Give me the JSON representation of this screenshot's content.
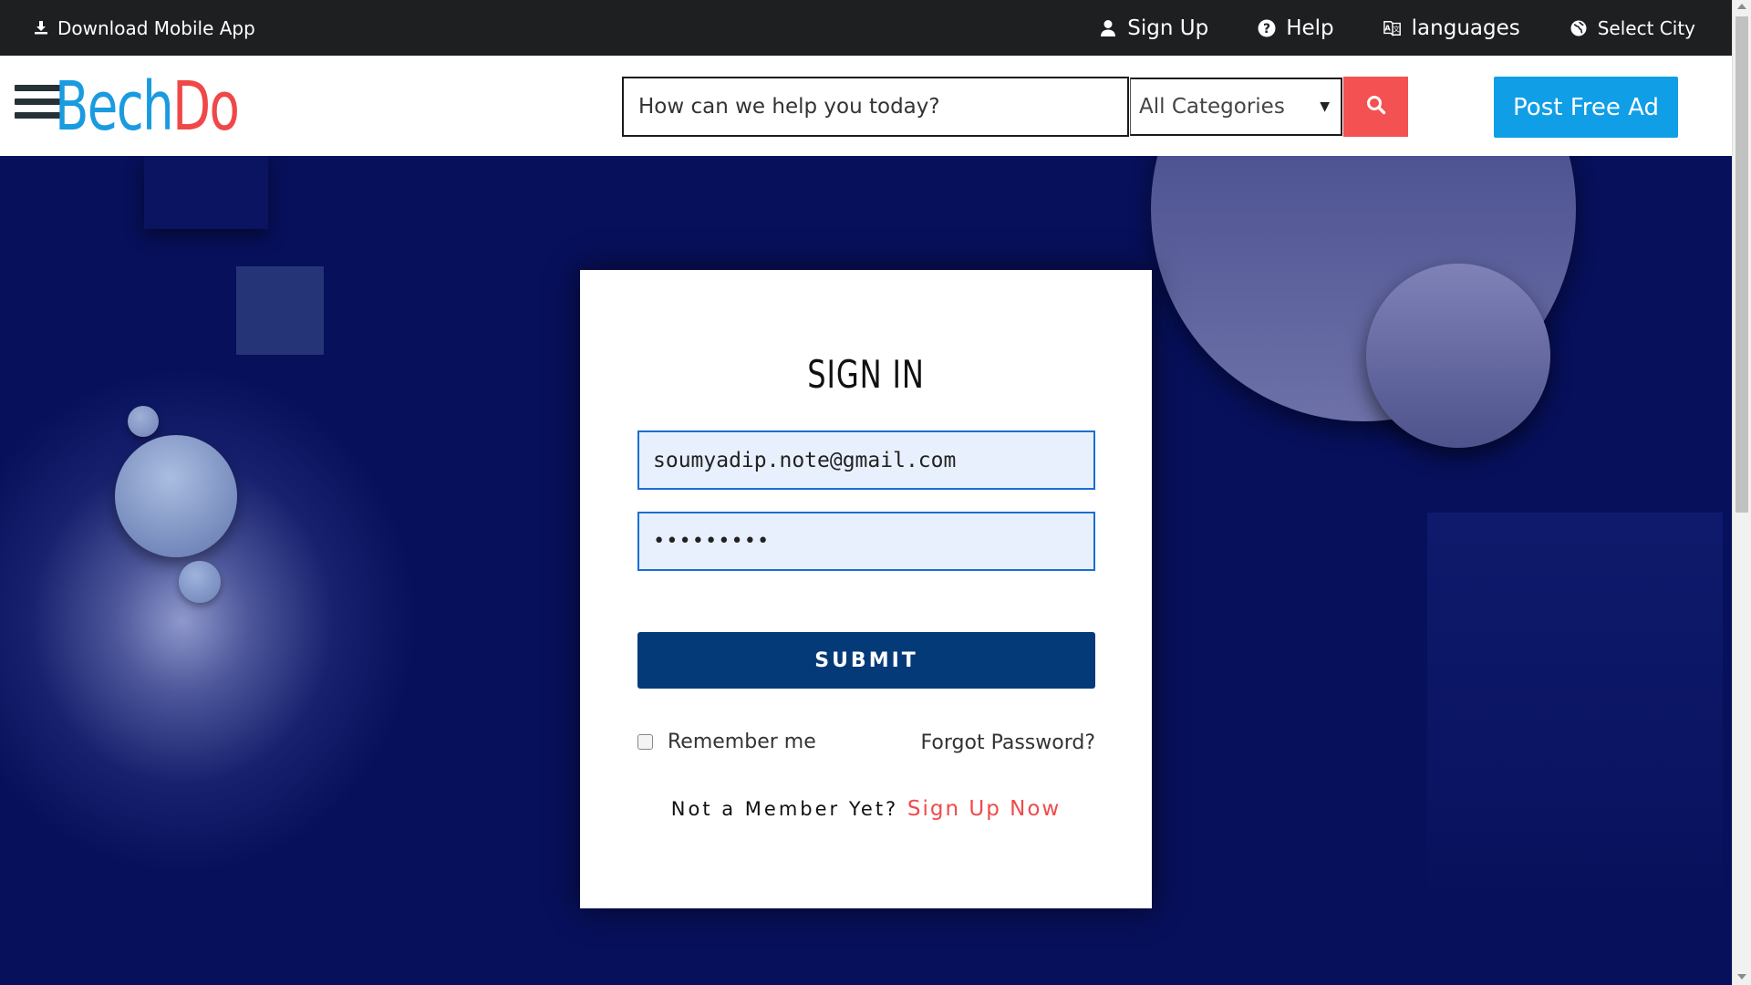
{
  "topbar": {
    "download_label": "Download Mobile App",
    "signup_label": "Sign Up",
    "help_label": "Help",
    "languages_label": "languages",
    "city_label": "Select City"
  },
  "header": {
    "logo_part1": "Bech",
    "logo_part2": "Do",
    "search_placeholder": "How can we help you today?",
    "category_selected": "All Categories",
    "post_ad_label": "Post Free Ad"
  },
  "signin": {
    "title": "SIGN IN",
    "email_value": "soumyadip.note@gmail.com",
    "password_value": "•••••••••",
    "submit_label": "SUBMIT",
    "remember_label": "Remember me",
    "forgot_label": "Forgot Password?",
    "member_prompt": "Not a Member Yet?",
    "signup_now_label": "Sign Up Now"
  },
  "colors": {
    "brand_blue": "#1a9be0",
    "brand_red": "#f04848",
    "submit_bg": "#053a78",
    "page_bg": "#07105a"
  },
  "icons": {
    "download": "download-icon",
    "user": "user-icon",
    "help": "question-circle-icon",
    "language": "language-icon",
    "city": "globe-icon",
    "search": "search-icon",
    "menu": "hamburger-menu-icon"
  }
}
